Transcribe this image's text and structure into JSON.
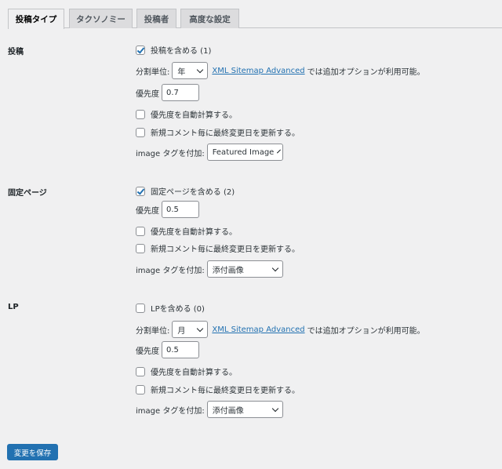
{
  "tabs": [
    {
      "label": "投稿タイプ",
      "active": true
    },
    {
      "label": "タクソノミー",
      "active": false
    },
    {
      "label": "投稿者",
      "active": false
    },
    {
      "label": "高度な設定",
      "active": false
    }
  ],
  "sections": {
    "post": {
      "title": "投稿",
      "include_label": "投稿を含める (1)",
      "include_checked": true,
      "split_label": "分割単位:",
      "split_value": "年",
      "addon_link": "XML Sitemap Advanced",
      "addon_text": "では追加オプションが利用可能。",
      "priority_label": "優先度",
      "priority_value": "0.7",
      "auto_priority_label": "優先度を自動計算する。",
      "auto_priority_checked": false,
      "update_comment_label": "新規コメント毎に最終変更日を更新する。",
      "update_comment_checked": false,
      "image_label": "image タグを付加:",
      "image_value": "Featured Image"
    },
    "page": {
      "title": "固定ページ",
      "include_label": "固定ページを含める (2)",
      "include_checked": true,
      "priority_label": "優先度",
      "priority_value": "0.5",
      "auto_priority_label": "優先度を自動計算する。",
      "auto_priority_checked": false,
      "update_comment_label": "新規コメント毎に最終変更日を更新する。",
      "update_comment_checked": false,
      "image_label": "image タグを付加:",
      "image_value": "添付画像"
    },
    "lp": {
      "title": "LP",
      "include_label": "LPを含める (0)",
      "include_checked": false,
      "split_label": "分割単位:",
      "split_value": "月",
      "addon_link": "XML Sitemap Advanced",
      "addon_text": "では追加オプションが利用可能。",
      "priority_label": "優先度",
      "priority_value": "0.5",
      "auto_priority_label": "優先度を自動計算する。",
      "auto_priority_checked": false,
      "update_comment_label": "新規コメント毎に最終変更日を更新する。",
      "update_comment_checked": false,
      "image_label": "image タグを付加:",
      "image_value": "添付画像"
    }
  },
  "save_label": "変更を保存",
  "colors": {
    "accent": "#2271b1",
    "background": "#f0f0f1"
  }
}
